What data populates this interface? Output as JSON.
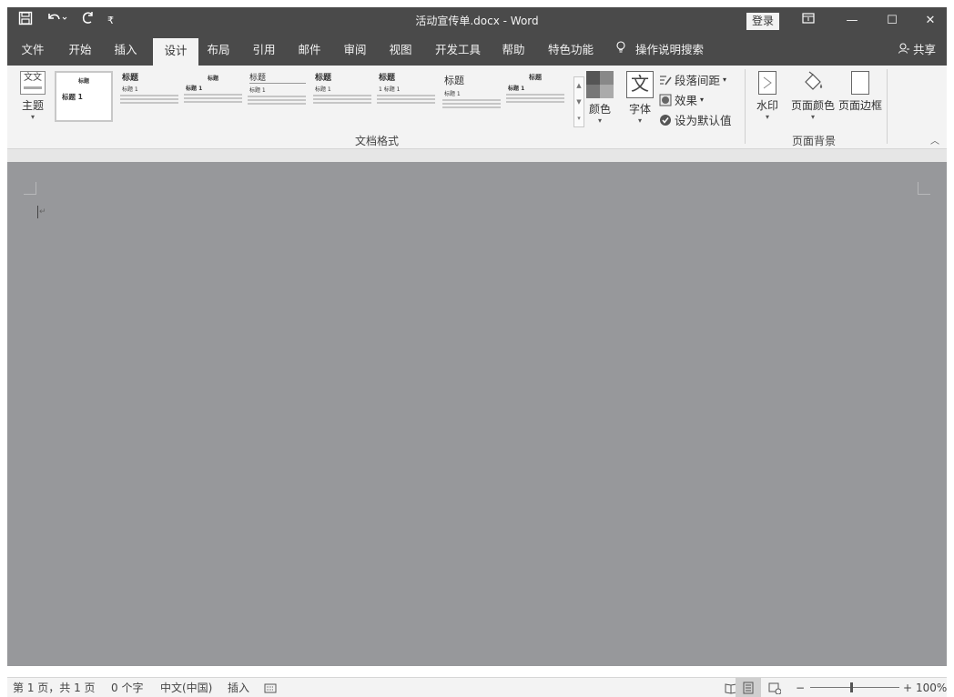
{
  "titlebar": {
    "document_title": "活动宣传单.docx  -  Word",
    "login_label": "登录",
    "qat": {
      "save_icon": "save-icon",
      "undo_icon": "undo-icon",
      "redo_icon": "redo-icon",
      "customize_icon": "customize-qat-icon"
    }
  },
  "tabs": [
    {
      "label": "文件"
    },
    {
      "label": "开始"
    },
    {
      "label": "插入"
    },
    {
      "label": "设计",
      "active": true
    },
    {
      "label": "布局"
    },
    {
      "label": "引用"
    },
    {
      "label": "邮件"
    },
    {
      "label": "审阅"
    },
    {
      "label": "视图"
    },
    {
      "label": "开发工具"
    },
    {
      "label": "帮助"
    },
    {
      "label": "特色功能"
    }
  ],
  "tell_me": "操作说明搜索",
  "share": "共享",
  "ribbon": {
    "theme_label": "主题",
    "theme_icon_text": "文文",
    "gallery": [
      {
        "title": "标题",
        "heading": "标题 1"
      },
      {
        "title": "标题",
        "heading": "标题 1"
      },
      {
        "title": "标题",
        "heading": "标题 1"
      },
      {
        "title": "标题",
        "heading": "标题 1"
      },
      {
        "title": "标题",
        "heading": "标题 1"
      },
      {
        "title": "标题",
        "heading": "1  标题 1"
      },
      {
        "title": "标题",
        "heading": "标题 1"
      },
      {
        "title": "标题",
        "heading": "标题 1"
      }
    ],
    "colors_label": "颜色",
    "fonts_label": "字体",
    "fonts_icon_text": "文",
    "paragraph_spacing_label": "段落间距",
    "effects_label": "效果",
    "set_default_label": "设为默认值",
    "document_format_group": "文档格式",
    "watermark_label": "水印",
    "page_color_label": "页面颜色",
    "page_border_label": "页面边框",
    "page_background_group": "页面背景"
  },
  "statusbar": {
    "page_info": "第 1 页，共 1 页",
    "word_count": "0 个字",
    "language": "中文(中国)",
    "insert_mode": "插入",
    "zoom": "100%"
  },
  "colors": {
    "titlebar_bg": "#4a4a4a",
    "ribbon_bg": "#f3f3f3",
    "page_color": "#97989b"
  }
}
